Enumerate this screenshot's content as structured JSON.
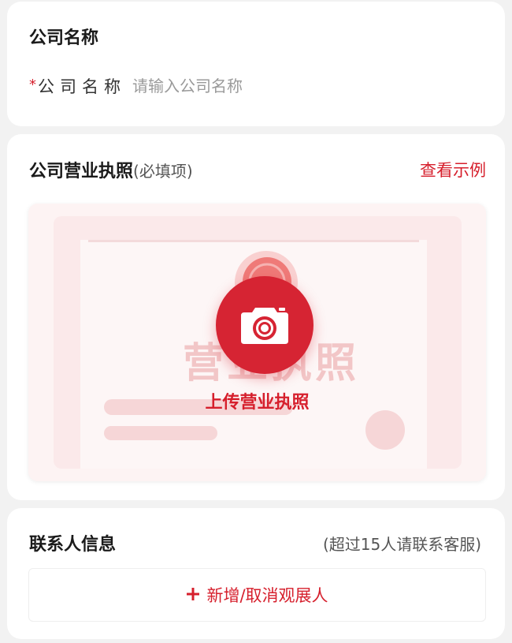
{
  "company": {
    "title": "公司名称",
    "required_mark": "*",
    "field_label": "公司名称",
    "input_value": "",
    "input_placeholder": "请输入公司名称"
  },
  "license": {
    "title": "公司营业执照",
    "title_note": "(必填项)",
    "example_link": "查看示例",
    "watermark_text": "营业执照",
    "upload_label": "上传营业执照",
    "upload_icon": "camera-icon"
  },
  "contact": {
    "title": "联系人信息",
    "note": "(超过15人请联系客服)",
    "add_icon": "plus",
    "add_label": "新增/取消观展人"
  },
  "colors": {
    "accent": "#d61f2c",
    "background": "#f2f2f2",
    "card": "#ffffff"
  }
}
